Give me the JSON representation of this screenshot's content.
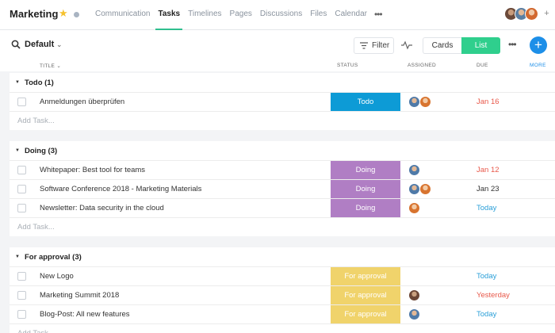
{
  "project": {
    "title": "Marketing"
  },
  "nav": {
    "tabs": [
      {
        "label": "Communication",
        "active": false
      },
      {
        "label": "Tasks",
        "active": true
      },
      {
        "label": "Timelines",
        "active": false
      },
      {
        "label": "Pages",
        "active": false
      },
      {
        "label": "Discussions",
        "active": false
      },
      {
        "label": "Files",
        "active": false
      },
      {
        "label": "Calendar",
        "active": false
      }
    ],
    "more": "•••"
  },
  "toolbar": {
    "view_name": "Default",
    "filter_label": "Filter",
    "cards_label": "Cards",
    "list_label": "List",
    "more": "•••",
    "add": "+"
  },
  "columns": {
    "title": "TITLE",
    "status": "STATUS",
    "assigned": "ASSIGNED",
    "due": "DUE",
    "more": "MORE"
  },
  "colors": {
    "accent_green": "#2fcf8d",
    "accent_blue": "#1d8fe8",
    "status_todo": "#0d9bd6",
    "status_doing": "#b07ec4",
    "status_approval": "#f0d36b",
    "due_overdue": "#e8584a",
    "due_today": "#2a9fd8",
    "due_normal": "#333333"
  },
  "sections": [
    {
      "title": "Todo (1)",
      "add_task": "Add Task...",
      "rows": [
        {
          "title": "Anmeldungen überprüfen",
          "status": "Todo",
          "status_kind": "todo",
          "assignees": [
            "avatar-blue",
            "avatar-orange"
          ],
          "due": "Jan 16",
          "due_kind": "overdue"
        }
      ]
    },
    {
      "title": "Doing (3)",
      "add_task": "Add Task...",
      "rows": [
        {
          "title": "Whitepaper: Best tool for teams",
          "status": "Doing",
          "status_kind": "doing",
          "assignees": [
            "avatar-blue"
          ],
          "due": "Jan 12",
          "due_kind": "overdue"
        },
        {
          "title": "Software Conference 2018 - Marketing Materials",
          "status": "Doing",
          "status_kind": "doing",
          "assignees": [
            "avatar-blue",
            "avatar-orange"
          ],
          "due": "Jan 23",
          "due_kind": "normal"
        },
        {
          "title": "Newsletter: Data security in the cloud",
          "status": "Doing",
          "status_kind": "doing",
          "assignees": [
            "avatar-orange"
          ],
          "due": "Today",
          "due_kind": "today"
        }
      ]
    },
    {
      "title": "For approval (3)",
      "add_task": "Add Task...",
      "rows": [
        {
          "title": "New Logo",
          "status": "For approval",
          "status_kind": "approval",
          "assignees": [],
          "due": "Today",
          "due_kind": "today"
        },
        {
          "title": "Marketing Summit 2018",
          "status": "For approval",
          "status_kind": "approval",
          "assignees": [
            "avatar-brown"
          ],
          "due": "Yesterday",
          "due_kind": "overdue"
        },
        {
          "title": "Blog-Post: All new features",
          "status": "For approval",
          "status_kind": "approval",
          "assignees": [
            "avatar-blue"
          ],
          "due": "Today",
          "due_kind": "today"
        }
      ]
    }
  ]
}
